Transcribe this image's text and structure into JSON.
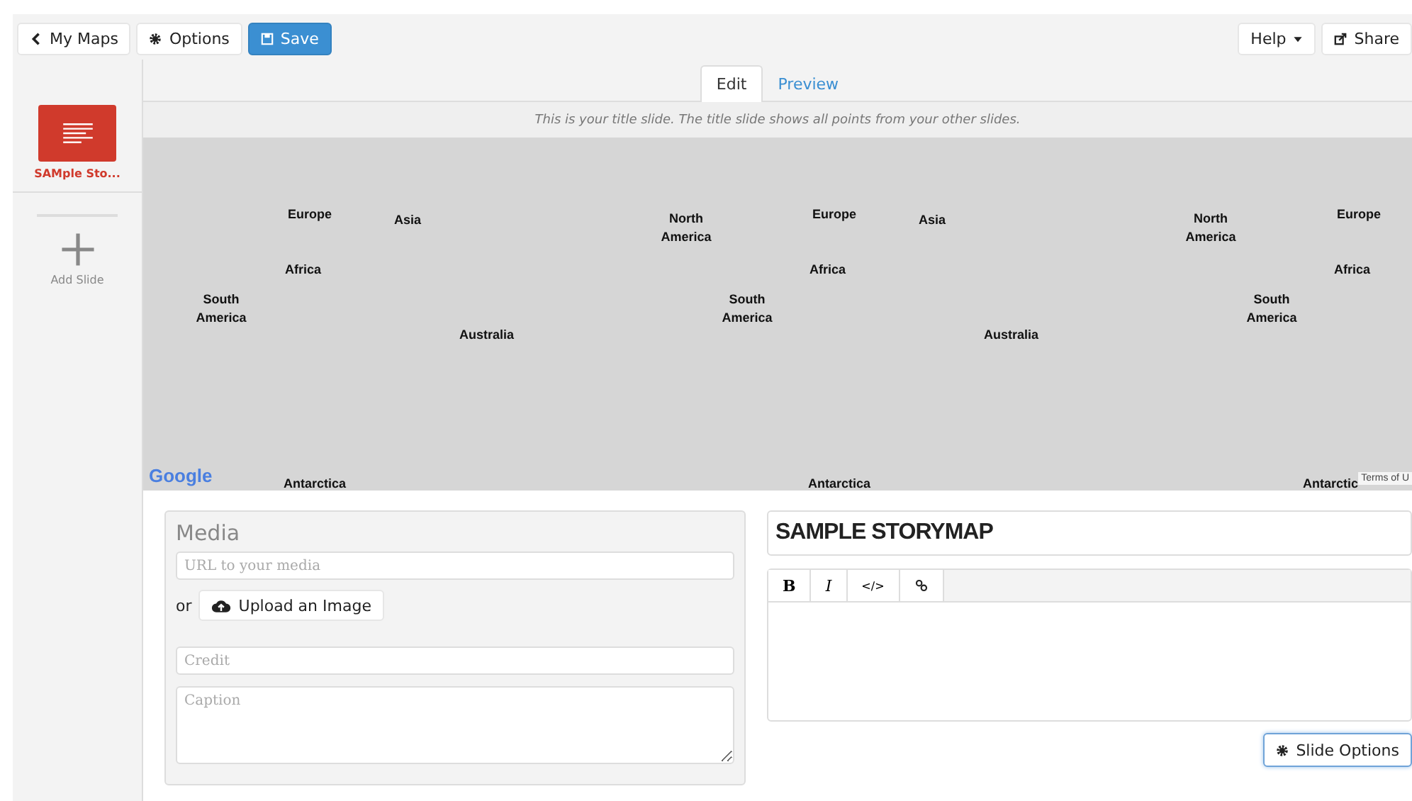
{
  "toolbar": {
    "left_buttons": [
      {
        "label": "My Maps",
        "kind": "back"
      },
      {
        "label": "Options",
        "kind": "settings"
      },
      {
        "label": "Save",
        "kind": "save"
      }
    ],
    "right_buttons": [
      {
        "label": "Help",
        "kind": "menu"
      },
      {
        "label": "Share",
        "kind": "share"
      }
    ]
  },
  "tabs": [
    {
      "label": "Edit",
      "selected": true
    },
    {
      "label": "Preview",
      "selected": false
    }
  ],
  "sidebar": {
    "slides": [
      {
        "label": "SAMple Sto...",
        "selected": true
      }
    ],
    "add_label": "Add Slide"
  },
  "map": {
    "notice": "This is your title slide. The title slide shows all points from your other slides.",
    "labels": [
      "Europe",
      "Asia",
      "North America",
      "Africa",
      "South America",
      "South America",
      "Australia",
      "Antarctica",
      "Europe",
      "Asia",
      "North America",
      "Africa",
      "Australia",
      "Antarctica",
      "Europe",
      "Africa",
      "South America",
      "Antarctic"
    ],
    "logo": "Google",
    "terms": "Terms of U"
  },
  "media": {
    "heading": "Media",
    "url_placeholder": "URL to your media",
    "or": "or",
    "upload_label": "Upload an Image",
    "credit_placeholder": "Credit",
    "caption_placeholder": "Caption"
  },
  "slide": {
    "title": "SAMPLE STORYMAP",
    "editor_buttons": [
      "B",
      "I",
      "</>"
    ],
    "options_label": "Slide Options"
  }
}
